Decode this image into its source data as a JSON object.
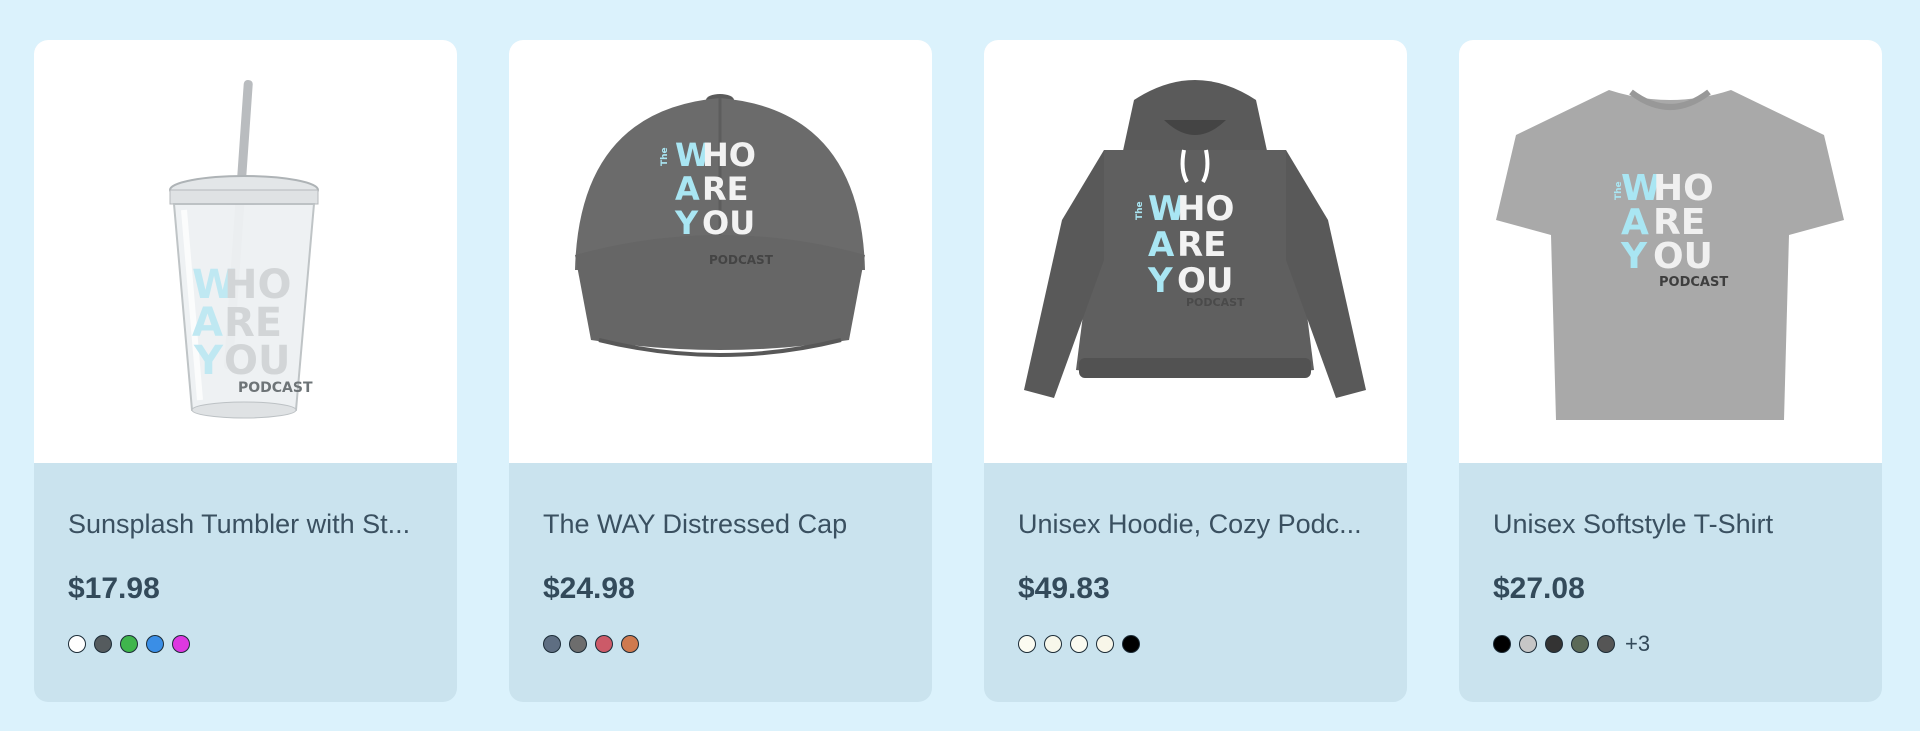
{
  "colors": {
    "page_bg": "#dbf2fc",
    "card_bg": "#cae3ee",
    "logo_accent": "#a9e6f3",
    "logo_light": "#f2f2f2"
  },
  "logo": {
    "the": "The",
    "line1_initial": "W",
    "line1_rest": "HO",
    "line2_initial": "A",
    "line2_rest": "RE",
    "line3_initial": "Y",
    "line3_rest": "OU",
    "sub": "PODCAST"
  },
  "products": [
    {
      "title": "Sunsplash Tumbler with St...",
      "price": "$17.98",
      "image_icon": "tumbler-image",
      "swatches": [
        "#ffffff",
        "#555b5e",
        "#3fb54c",
        "#3a8ee6",
        "#dd38e0"
      ],
      "more": ""
    },
    {
      "title": "The WAY Distressed Cap",
      "price": "$24.98",
      "image_icon": "cap-image",
      "swatches": [
        "#5e6e82",
        "#6d6d6d",
        "#cc5a68",
        "#cf7a4f"
      ],
      "more": ""
    },
    {
      "title": "Unisex Hoodie, Cozy Podc...",
      "price": "$49.83",
      "image_icon": "hoodie-image",
      "swatches": [
        "#fbfbf1",
        "#f7f7ea",
        "#fafaf0",
        "#f8f6e9",
        "#000000"
      ],
      "more": ""
    },
    {
      "title": "Unisex Softstyle T-Shirt",
      "price": "$27.08",
      "image_icon": "tshirt-image",
      "swatches": [
        "#000000",
        "#c6c6c6",
        "#333333",
        "#5b6a58",
        "#555555"
      ],
      "more": "+3"
    }
  ]
}
